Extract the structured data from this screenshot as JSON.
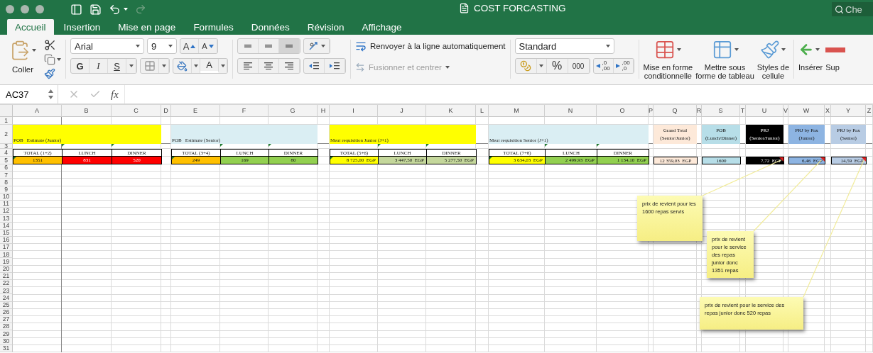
{
  "window": {
    "title": "COST FORCASTING",
    "search_placeholder": "Che"
  },
  "quick_access": {
    "redo_disabled": true
  },
  "tabs": [
    {
      "label": "Accueil",
      "selected": true
    },
    {
      "label": "Insertion",
      "selected": false
    },
    {
      "label": "Mise en page",
      "selected": false
    },
    {
      "label": "Formules",
      "selected": false
    },
    {
      "label": "Données",
      "selected": false
    },
    {
      "label": "Révision",
      "selected": false
    },
    {
      "label": "Affichage",
      "selected": false
    }
  ],
  "ribbon": {
    "paste_label": "Coller",
    "font_name": "Arial",
    "font_size": "9",
    "grow_font": "A",
    "shrink_font": "A",
    "bold": "G",
    "italic": "I",
    "underline": "S",
    "font_color": "A",
    "vertical_align": [
      {
        "selected": false
      },
      {
        "selected": false
      },
      {
        "selected": true
      }
    ],
    "wrap_text": "Renvoyer à la ligne automatiquement",
    "merge": {
      "label": "Fusionner et centrer",
      "disabled": true
    },
    "number_format": "Standard",
    "percent": "%",
    "thousands": "000",
    "decimals": [
      {
        "top": ",0",
        "bottom": ",00"
      },
      {
        "top": ",00",
        "bottom": ",0"
      }
    ],
    "styles": [
      {
        "lines": [
          "Mise en forme",
          "conditionnelle"
        ]
      },
      {
        "lines": [
          "Mettre sous",
          "forme de tableau"
        ]
      },
      {
        "lines": [
          "Styles de",
          "cellule"
        ]
      }
    ],
    "cells": [
      "Insérer",
      "Sup"
    ]
  },
  "formula_bar": {
    "name_box": "AC37",
    "fx": "fx",
    "confirm_disabled": true
  },
  "sheet": {
    "columns": [
      "A",
      "B",
      "C",
      "D",
      "E",
      "F",
      "G",
      "H",
      "I",
      "J",
      "K",
      "L",
      "M",
      "N",
      "O",
      "P",
      "Q",
      "R",
      "S",
      "T",
      "U",
      "V",
      "W",
      "X",
      "Y",
      "Z"
    ],
    "rows": [
      "1",
      "2",
      "3",
      "4",
      "5",
      "6",
      "7",
      "8",
      "9",
      "10",
      "11",
      "12",
      "13",
      "14",
      "15",
      "16",
      "17",
      "18",
      "19",
      "20",
      "21",
      "22",
      "23",
      "24",
      "25",
      "26",
      "27",
      "28",
      "29",
      "30",
      "31"
    ],
    "blocks": [
      {
        "title": "POB   Estimate (Junior)",
        "color": "#ffff00",
        "kind": "count",
        "headers": [
          {
            "label": "TOTAL (1+2)",
            "flagged": false
          },
          {
            "label": "LUNCH",
            "flagged": true
          },
          {
            "label": "DINNER",
            "flagged": true
          }
        ],
        "values": [
          {
            "text": "1351",
            "color": "#ffc000",
            "flagged": true
          },
          {
            "text": "831",
            "color": "#ff0000",
            "flagged": false
          },
          {
            "text": "520",
            "color": "#ff0000",
            "flagged": false
          }
        ]
      },
      {
        "title": "POB   Estimate (Senior)",
        "color": "#daeef3",
        "kind": "count",
        "headers": [
          {
            "label": "TOTAL (3+4)",
            "flagged": false
          },
          {
            "label": "LUNCH",
            "flagged": true
          },
          {
            "label": "DINNER",
            "flagged": true
          }
        ],
        "values": [
          {
            "text": "249",
            "color": "#ffc000",
            "flagged": true
          },
          {
            "text": "169",
            "color": "#92d050",
            "flagged": false
          },
          {
            "text": "80",
            "color": "#92d050",
            "flagged": false
          }
        ]
      },
      {
        "title": "Meat requisition Junior (J+1)",
        "color": "#ffff00",
        "kind": "amount",
        "headers": [
          {
            "label": "TOTAL (5+6)",
            "flagged": false
          },
          {
            "label": "LUNCH",
            "flagged": true
          },
          {
            "label": "DINNER",
            "flagged": true
          }
        ],
        "values": [
          {
            "text": "8 725,00  EGP",
            "color": "#ffff00",
            "flagged": true
          },
          {
            "text": "3 447,50  EGP",
            "color": "#c4d79b",
            "flagged": false
          },
          {
            "text": "5 277,50  EGP",
            "color": "#c4d79b",
            "flagged": false
          }
        ]
      },
      {
        "title": "Meat requisition Senior (J+1)",
        "color": "#daeef3",
        "kind": "amount",
        "headers": [
          {
            "label": "TOTAL (7+8)",
            "flagged": false
          },
          {
            "label": "LUNCH",
            "flagged": true
          },
          {
            "label": "DINNER",
            "flagged": true
          }
        ],
        "values": [
          {
            "text": "3 634,03  EGP",
            "color": "#ffff00",
            "flagged": true
          },
          {
            "text": "2 499,93  EGP",
            "color": "#92d050",
            "flagged": false
          },
          {
            "text": "1 134,10  EGP",
            "color": "#92d050",
            "flagged": false
          }
        ]
      }
    ],
    "summary": [
      {
        "title_lines": [
          "Grand Total",
          "(Senior/Junior)"
        ],
        "color": "#fde9d9",
        "value": "12 359,03  EGP",
        "kind": "count",
        "commented": false
      },
      {
        "title_lines": [
          "POB",
          "(Lunch/Dinner)"
        ],
        "color": "#b7dee8",
        "value": "1600",
        "kind": "count",
        "commented": false
      },
      {
        "title_lines": [
          "PRJ",
          "(Senior/Junior)"
        ],
        "color": "#000000",
        "value": "7,72  EGP",
        "kind": "amount",
        "commented": true
      },
      {
        "title_lines": [
          "PRJ by Pax",
          "(Junior)"
        ],
        "color": "#8db4e2",
        "value": "6,46  EGP",
        "kind": "amount",
        "commented": true
      },
      {
        "title_lines": [
          "PRJ by Pax",
          "(Senior)"
        ],
        "color": "#b8cce4",
        "value": "14,59  EGP",
        "kind": "amount",
        "commented": true
      }
    ]
  },
  "comments": [
    {
      "text": "prix de revient pour les 1600 repas servis"
    },
    {
      "text": "prix de revient pour le service des repas junior donc 1351 repas"
    },
    {
      "text": "prix de revient pour le service des repas junior donc 520 repas"
    }
  ]
}
